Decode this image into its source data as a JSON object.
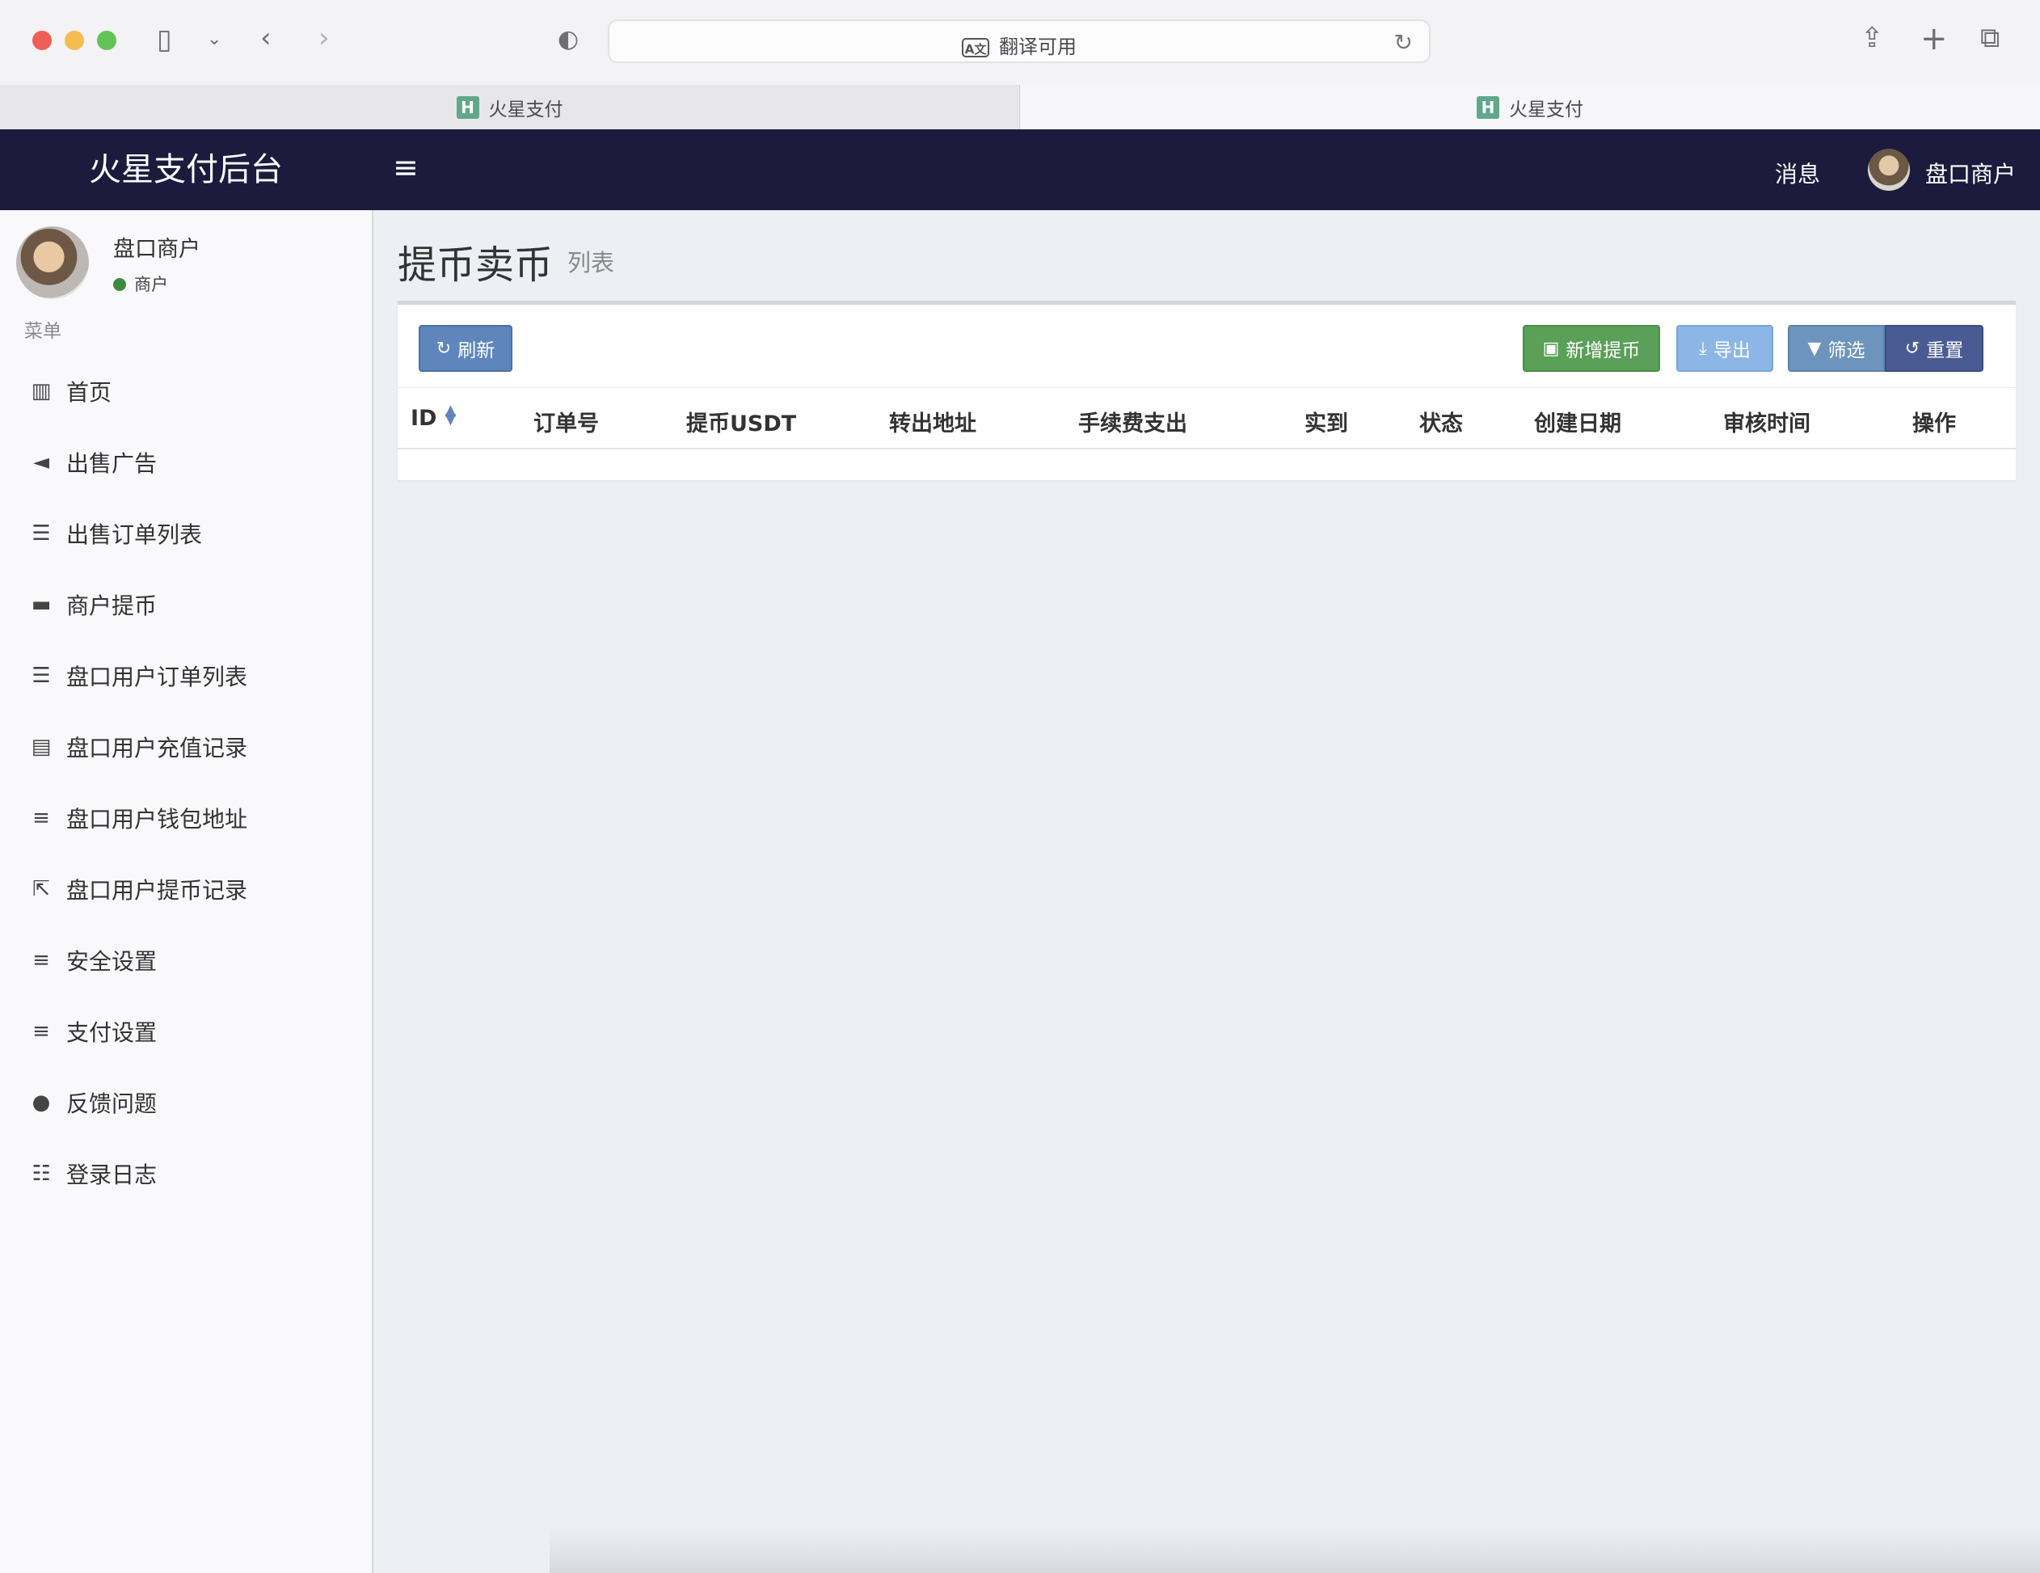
{
  "browser": {
    "address_text": "翻译可用",
    "tabs": [
      {
        "title": "火星支付",
        "favicon": "H"
      },
      {
        "title": "火星支付",
        "favicon": "H"
      }
    ]
  },
  "header": {
    "logo": "火星支付后台",
    "messages": "消息",
    "username": "盘口商户",
    "background": "#1c1b3d"
  },
  "sidebar": {
    "user_name": "盘口商户",
    "user_role": "商户",
    "menu_header": "菜单",
    "items": [
      {
        "label": "首页",
        "icon": "bar-chart-icon"
      },
      {
        "label": "出售广告",
        "icon": "megaphone-icon"
      },
      {
        "label": "出售订单列表",
        "icon": "list-icon"
      },
      {
        "label": "商户提币",
        "icon": "credit-card-icon"
      },
      {
        "label": "盘口用户订单列表",
        "icon": "list-icon"
      },
      {
        "label": "盘口用户充值记录",
        "icon": "building-icon"
      },
      {
        "label": "盘口用户钱包地址",
        "icon": "bars-icon"
      },
      {
        "label": "盘口用户提币记录",
        "icon": "external-link-icon"
      },
      {
        "label": "安全设置",
        "icon": "bars-icon"
      },
      {
        "label": "支付设置",
        "icon": "bars-icon"
      },
      {
        "label": "反馈问题",
        "icon": "comment-icon"
      },
      {
        "label": "登录日志",
        "icon": "ordered-list-icon"
      }
    ]
  },
  "content": {
    "title": "提币卖币",
    "subtitle": "列表",
    "buttons": {
      "refresh": "刷新",
      "add": "新增提币",
      "export": "导出",
      "filter": "筛选",
      "reset": "重置"
    },
    "columns": [
      "ID",
      "订单号",
      "提币USDT",
      "转出地址",
      "手续费支出",
      "实到",
      "状态",
      "创建日期",
      "审核时间",
      "操作"
    ]
  }
}
